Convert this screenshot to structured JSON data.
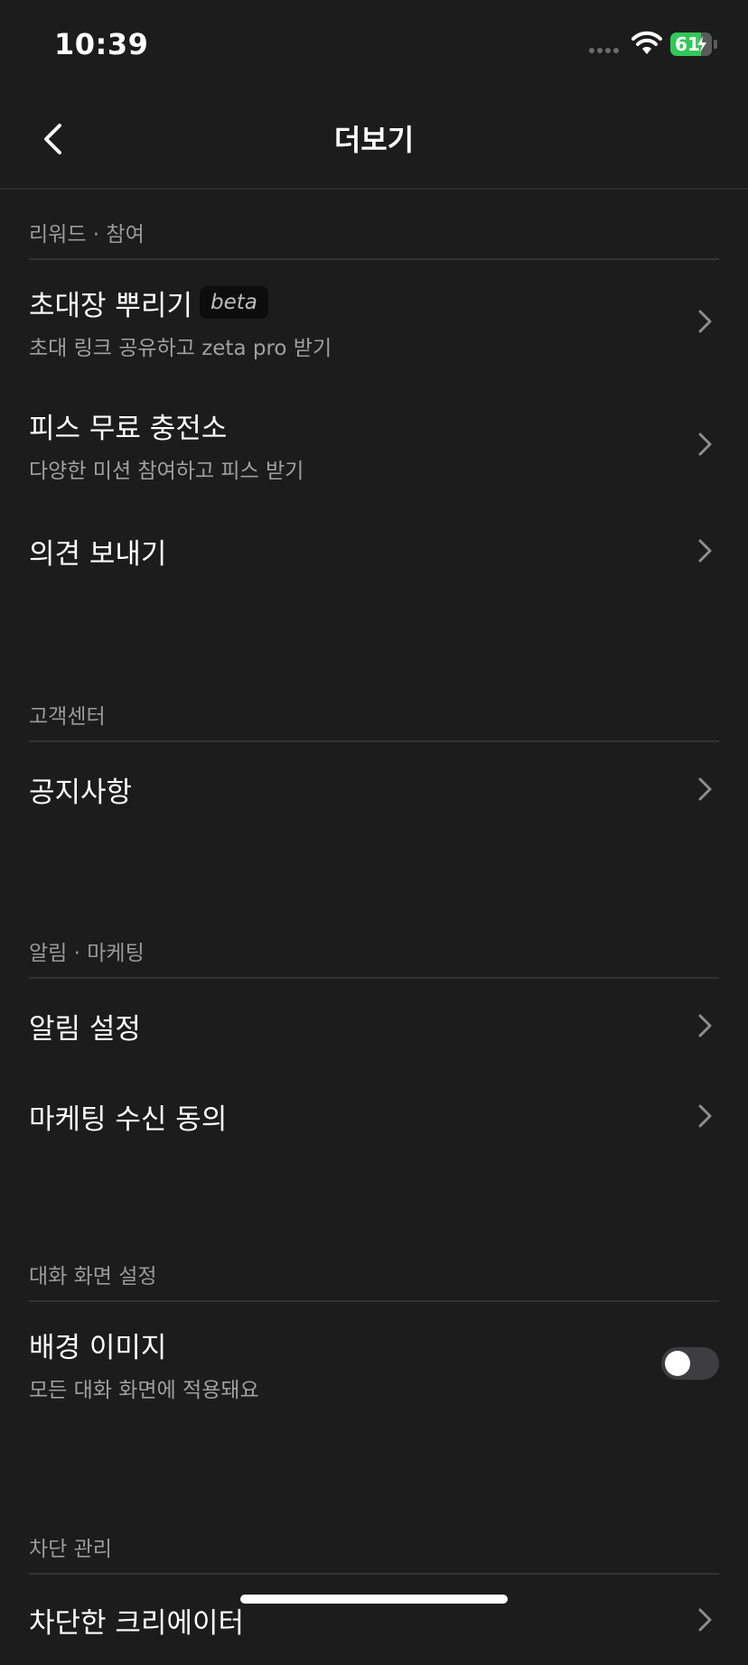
{
  "status_bar": {
    "time": "10:39",
    "battery_level": "61"
  },
  "nav": {
    "title": "더보기"
  },
  "sections": {
    "reward": {
      "header": "리워드 · 참여",
      "invite": {
        "title": "초대장 뿌리기",
        "badge": "beta",
        "subtitle": "초대 링크 공유하고 zeta pro 받기"
      },
      "charge": {
        "title": "피스 무료 충전소",
        "subtitle": "다양한 미션 참여하고 피스 받기"
      },
      "feedback": {
        "title": "의견 보내기"
      }
    },
    "support": {
      "header": "고객센터",
      "notice": {
        "title": "공지사항"
      }
    },
    "alerts": {
      "header": "알림 · 마케팅",
      "notification_settings": {
        "title": "알림 설정"
      },
      "marketing_consent": {
        "title": "마케팅 수신 동의"
      }
    },
    "chat_screen": {
      "header": "대화 화면 설정",
      "background_image": {
        "title": "배경 이미지",
        "subtitle": "모든 대화 화면에 적용돼요",
        "enabled": false
      }
    },
    "block": {
      "header": "차단 관리",
      "blocked_creators": {
        "title": "차단한 크리에이터"
      }
    }
  },
  "colors": {
    "background": "#1c1c1c",
    "battery_green": "#33c759",
    "toggle_off": "#3e3e40"
  }
}
